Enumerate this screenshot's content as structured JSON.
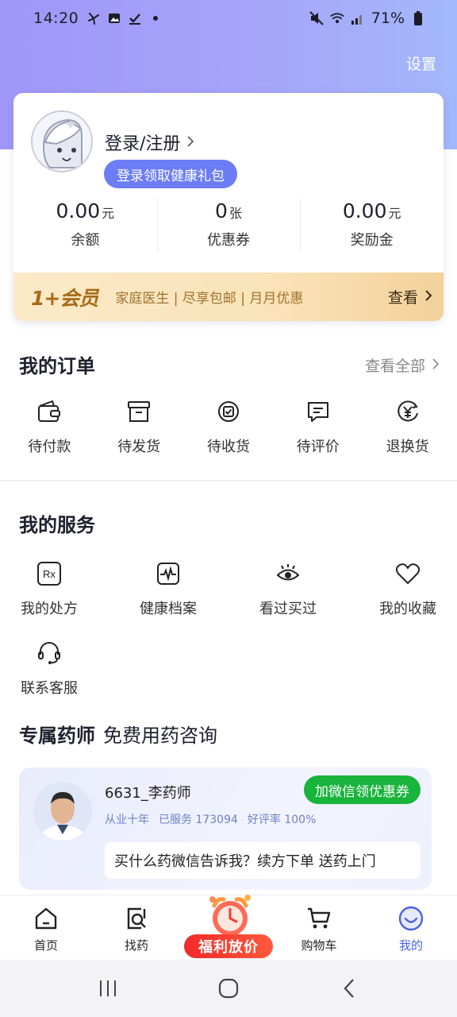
{
  "status_bar": {
    "time": "14:20",
    "battery": "71%",
    "icons": [
      "windmill-icon",
      "image-icon",
      "check-icon",
      "dot-icon",
      "mute-icon",
      "wifi-icon",
      "signal-icon",
      "battery-icon"
    ]
  },
  "header": {
    "settings_label": "设置"
  },
  "profile": {
    "login_label": "登录/注册",
    "gift_label": "登录领取健康礼包",
    "stats": [
      {
        "value": "0.00",
        "unit": "元",
        "label": "余额"
      },
      {
        "value": "0",
        "unit": "张",
        "label": "优惠券"
      },
      {
        "value": "0.00",
        "unit": "元",
        "label": "奖励金"
      }
    ],
    "member": {
      "logo": "1+会员",
      "perks": "家庭医生 | 尽享包邮 | 月月优惠",
      "view_label": "查看"
    }
  },
  "orders": {
    "title": "我的订单",
    "view_all": "查看全部",
    "items": [
      {
        "label": "待付款",
        "icon": "wallet-icon"
      },
      {
        "label": "待发货",
        "icon": "box-icon"
      },
      {
        "label": "待收货",
        "icon": "receive-icon"
      },
      {
        "label": "待评价",
        "icon": "comment-icon"
      },
      {
        "label": "退换货",
        "icon": "refund-icon"
      }
    ]
  },
  "services": {
    "title": "我的服务",
    "items": [
      {
        "label": "我的处方",
        "icon": "rx-icon"
      },
      {
        "label": "健康档案",
        "icon": "pulse-icon"
      },
      {
        "label": "看过买过",
        "icon": "eye-icon"
      },
      {
        "label": "我的收藏",
        "icon": "heart-icon"
      },
      {
        "label": "联系客服",
        "icon": "headset-icon"
      }
    ]
  },
  "pharmacist": {
    "title": "专属药师",
    "subtitle": "免费用药咨询",
    "name": "6631_李药师",
    "wechat_button": "加微信领优惠券",
    "stats": [
      "从业十年",
      "已服务 173094",
      "好评率 100%"
    ],
    "message": "买什么药微信告诉我？续方下单 送药上门"
  },
  "tabbar": {
    "items": [
      {
        "label": "首页",
        "icon": "home-icon"
      },
      {
        "label": "找药",
        "icon": "search-drug-icon"
      },
      {
        "label": "购物车",
        "icon": "cart-icon"
      },
      {
        "label": "我的",
        "icon": "smile-icon",
        "active": true
      }
    ],
    "promo_label": "福利放价"
  },
  "colors": {
    "accent": "#4b63e6",
    "hero_start": "#9f97f8",
    "hero_end": "#a3b8fb",
    "wechat_green": "#18b43b",
    "promo_red": "#f02a2a"
  }
}
